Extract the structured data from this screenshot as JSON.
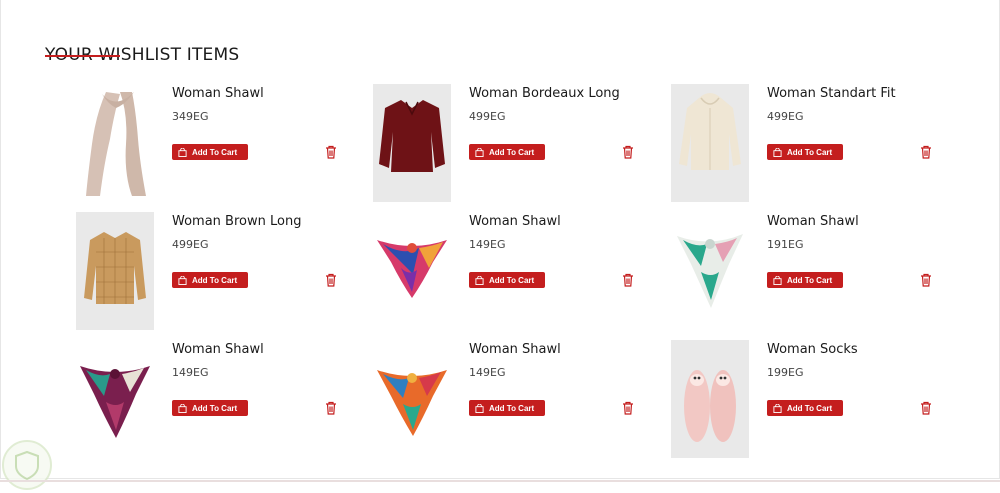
{
  "page": {
    "title": "YOUR WISHLIST ITEMS"
  },
  "colors": {
    "accent": "#c41e1e"
  },
  "items": [
    {
      "name": "Woman Shawl",
      "price": "349EG",
      "button": "Add To Cart",
      "image": "beige-scarf"
    },
    {
      "name": "Woman Bordeaux Long",
      "price": "499EG",
      "button": "Add To Cart",
      "image": "bordeaux-blouse"
    },
    {
      "name": "Woman Standart Fit",
      "price": "499EG",
      "button": "Add To Cart",
      "image": "cream-hoodie"
    },
    {
      "name": "Woman Brown Long",
      "price": "499EG",
      "button": "Add To Cart",
      "image": "brown-check-shirt"
    },
    {
      "name": "Woman Shawl",
      "price": "149EG",
      "button": "Add To Cart",
      "image": "multicolor-scarf"
    },
    {
      "name": "Woman Shawl",
      "price": "191EG",
      "button": "Add To Cart",
      "image": "green-print-scarf"
    },
    {
      "name": "Woman Shawl",
      "price": "149EG",
      "button": "Add To Cart",
      "image": "purple-print-scarf"
    },
    {
      "name": "Woman Shawl",
      "price": "149EG",
      "button": "Add To Cart",
      "image": "orange-print-scarf"
    },
    {
      "name": "Woman Socks",
      "price": "199EG",
      "button": "Add To Cart",
      "image": "pink-fluffy-socks"
    }
  ],
  "icons": {
    "cart": "shopping-bag-icon",
    "remove": "trash-icon"
  }
}
